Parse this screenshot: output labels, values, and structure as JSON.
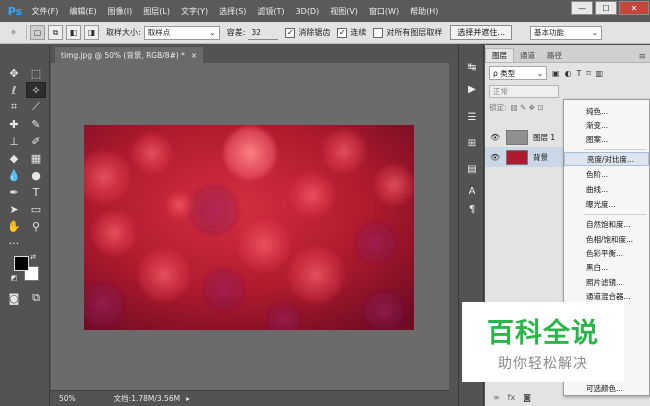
{
  "app": {
    "logo": "Ps"
  },
  "menubar": {
    "items": [
      "文件(F)",
      "编辑(E)",
      "图像(I)",
      "图层(L)",
      "文字(Y)",
      "选择(S)",
      "滤镜(T)",
      "3D(D)",
      "视图(V)",
      "窗口(W)",
      "帮助(H)"
    ],
    "minimize": "—",
    "maximize": "☐",
    "close": "✕"
  },
  "options": {
    "sample_size_label": "取样大小:",
    "sample_size_value": "取样点",
    "tolerance_label": "容差:",
    "tolerance_value": "32",
    "antialias_label": "消除锯齿",
    "antialias_checked": true,
    "contiguous_label": "连续",
    "contiguous_checked": true,
    "all_layers_label": "对所有图层取样",
    "all_layers_checked": false,
    "refine_button": "选择并遮住...",
    "workspace_value": "基本功能"
  },
  "document": {
    "tab_title": "timg.jpg @ 50% (背景, RGB/8#) *",
    "tab_close": "×",
    "zoom": "50%",
    "doc_info": "文档:1.78M/3.56M",
    "status_arrow": "▸"
  },
  "colors": {
    "foreground": "#000000",
    "background": "#ffffff",
    "canvas_base": "#b01a2e",
    "accent_watermark": "#2bb54a"
  },
  "layers_panel": {
    "tabs": [
      "图层",
      "通道",
      "路径"
    ],
    "active_tab": "图层",
    "filter_label": "ρ 类型",
    "blend_mode": "正常",
    "lock_label": "锁定:",
    "layers": [
      {
        "name": "图层 1",
        "visible": true
      },
      {
        "name": "背景",
        "visible": true
      }
    ],
    "bottom_icons": [
      "∞",
      "fx"
    ]
  },
  "context_menu": {
    "items": [
      "纯色...",
      "渐变...",
      "图案...",
      "亮度/对比度...",
      "色阶...",
      "曲线...",
      "曝光度...",
      "自然饱和度...",
      "色相/饱和度...",
      "色彩平衡...",
      "黑白...",
      "照片滤镜...",
      "通道混合器...",
      "可选颜色..."
    ],
    "highlighted": "亮度/对比度..."
  },
  "watermark": {
    "title": "百科全说",
    "subtitle": "助你轻松解决"
  }
}
